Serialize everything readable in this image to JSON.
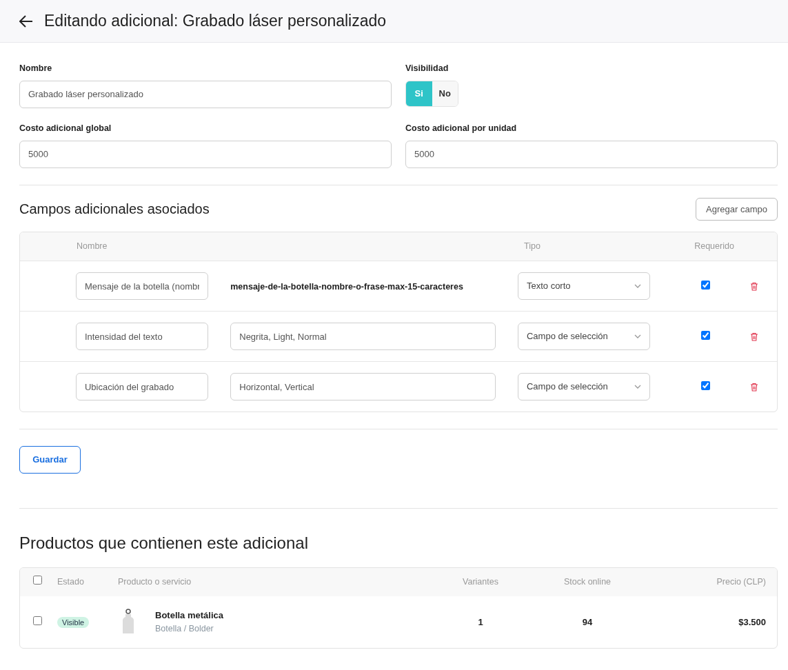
{
  "header": {
    "title": "Editando adicional: Grabado láser personalizado"
  },
  "form": {
    "name": {
      "label": "Nombre",
      "value": "Grabado láser personalizado"
    },
    "visibility": {
      "label": "Visibilidad",
      "options": [
        {
          "label": "Si",
          "selected": true
        },
        {
          "label": "No",
          "selected": false
        }
      ]
    },
    "global_cost": {
      "label": "Costo adicional global",
      "value": "5000"
    },
    "unit_cost": {
      "label": "Costo adicional por unidad",
      "value": "5000"
    }
  },
  "fields_section": {
    "title": "Campos adicionales asociados",
    "add_button": "Agregar campo",
    "columns": [
      "Nombre",
      "Tipo",
      "Requerido"
    ],
    "rows": [
      {
        "name": "Mensaje de la botella (nombr",
        "kind": "slug",
        "detail": "mensaje-de-la-botella-nombre-o-frase-max-15-caracteres",
        "type": "Texto corto",
        "required": true
      },
      {
        "name": "Intensidad del texto",
        "kind": "options",
        "detail": "Negrita, Light, Normal",
        "type": "Campo de selección",
        "required": true
      },
      {
        "name": "Ubicación del grabado",
        "kind": "options",
        "detail": "Horizontal, Vertical",
        "type": "Campo de selección",
        "required": true
      }
    ]
  },
  "save_button": "Guardar",
  "products_section": {
    "title": "Productos que contienen este adicional",
    "columns": [
      "Estado",
      "Producto o servicio",
      "Variantes",
      "Stock online",
      "Precio (CLP)"
    ],
    "all_checked": false,
    "rows": [
      {
        "checked": false,
        "status": "Visible",
        "name": "Botella metálica",
        "category": "Botella / Bolder",
        "variants": "1",
        "stock": "94",
        "price": "$3.500"
      }
    ]
  }
}
